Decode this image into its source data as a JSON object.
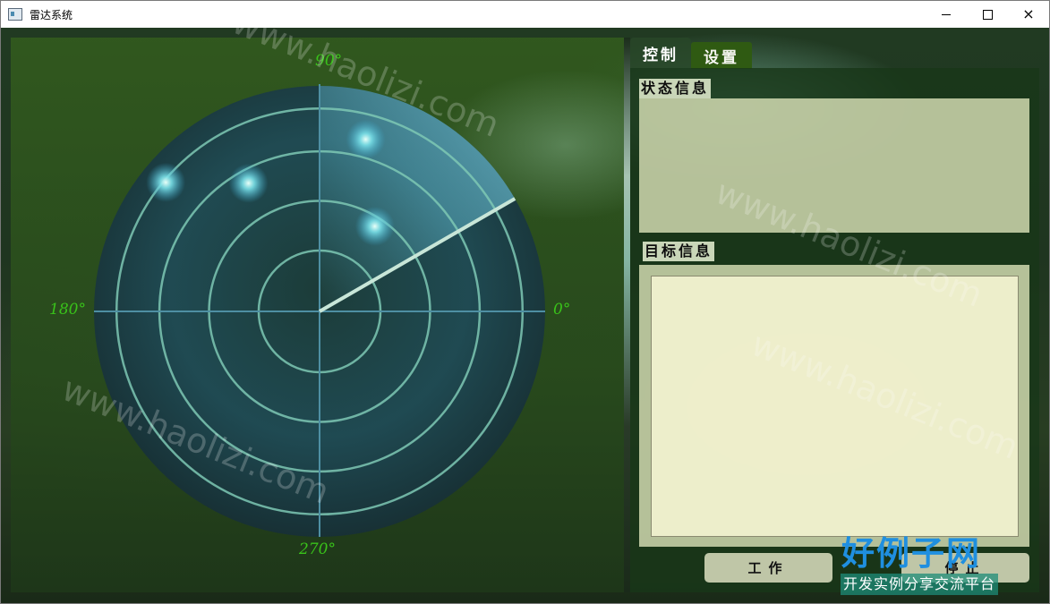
{
  "window": {
    "title": "雷达系统",
    "controls": {
      "minimize": "minimize",
      "maximize": "maximize",
      "close": "×"
    }
  },
  "radar": {
    "angle_labels": {
      "top": "90°",
      "left": "180°",
      "right": "0°",
      "bottom": "270°"
    },
    "ring_color": "#7ec8b4",
    "sweep_color": "#c8e6d8",
    "label_color": "#39c21a",
    "targets": [
      {
        "angle_deg": 140,
        "range": 0.89
      },
      {
        "angle_deg": 119,
        "range": 0.65
      },
      {
        "angle_deg": 75,
        "range": 0.79
      },
      {
        "angle_deg": 57,
        "range": 0.45
      }
    ],
    "sweep_angle_deg": 30
  },
  "tabs": [
    {
      "label": "控制",
      "active": true
    },
    {
      "label": "设置",
      "active": false
    }
  ],
  "sections": {
    "status_label": "状态信息",
    "status_text": "",
    "target_label": "目标信息",
    "target_text": ""
  },
  "buttons": {
    "work": "工作",
    "stop": "停止"
  },
  "watermark": {
    "text": "www.haolizi.com",
    "brand": "好例子网",
    "brand_sub": "开发实例分享交流平台",
    "brand_color": "#1f8fe0"
  }
}
